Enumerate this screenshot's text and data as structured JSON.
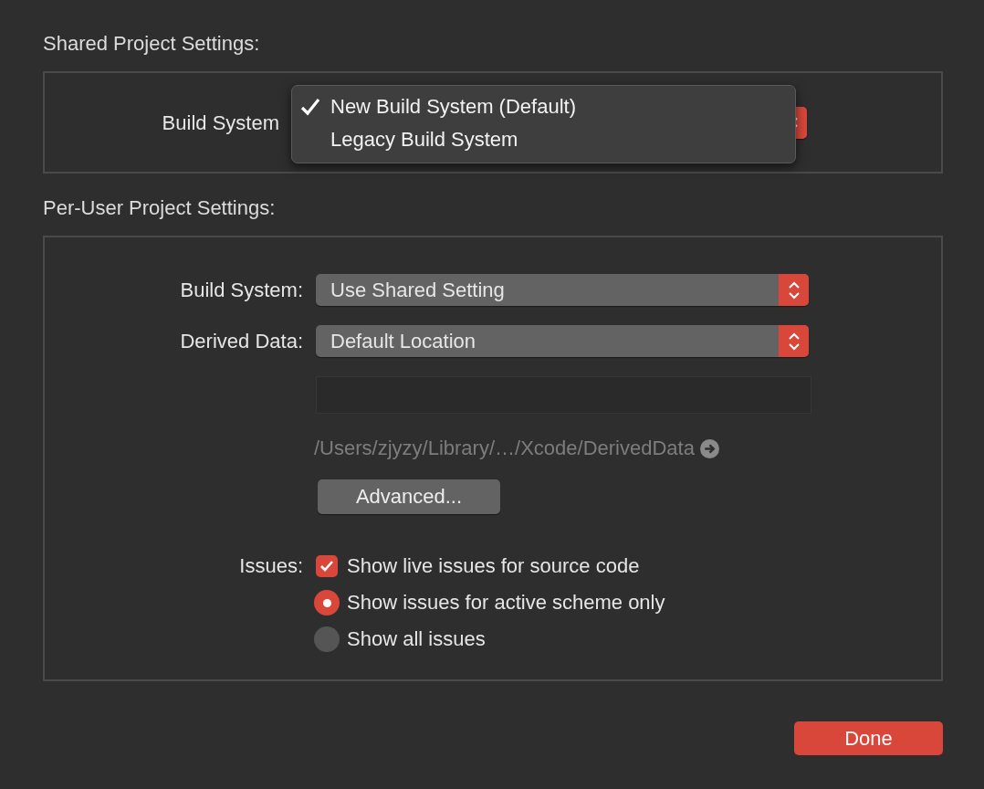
{
  "shared": {
    "heading": "Shared Project Settings:",
    "build_system": {
      "label": "Build System",
      "menu": {
        "open": true,
        "options": [
          {
            "label": "New Build System (Default)",
            "selected": true
          },
          {
            "label": "Legacy Build System",
            "selected": false
          }
        ]
      }
    }
  },
  "per_user": {
    "heading": "Per-User Project Settings:",
    "fields": [
      {
        "label": "Build System:",
        "value": "Use Shared Setting"
      },
      {
        "label": "Derived Data:",
        "value": "Default Location"
      }
    ],
    "path": "/Users/zjyzy/Library/…/Xcode/DerivedData",
    "advanced_button": "Advanced...",
    "issues": {
      "label": "Issues:",
      "options": [
        {
          "kind": "checkbox",
          "label": "Show live issues for source code",
          "checked": true
        },
        {
          "kind": "radio",
          "label": "Show issues for active scheme only",
          "selected": true
        },
        {
          "kind": "radio",
          "label": "Show all issues",
          "selected": false
        }
      ]
    }
  },
  "done_button": "Done"
}
